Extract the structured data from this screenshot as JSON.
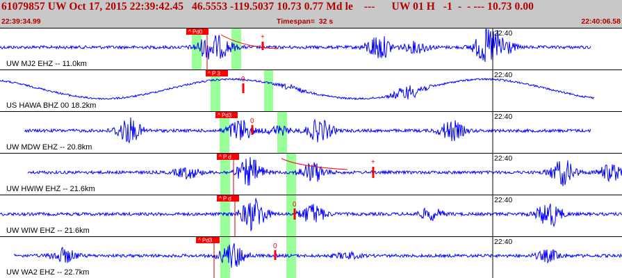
{
  "header": {
    "title": "61079857 UW Oct 17, 2015 22:39:42.45   46.5553 -119.5037 10.73 0.77 Md le    ---      UW 01 H   -1  -  - --- 10.73 0.00",
    "start_time": "22:39:34.99",
    "timespan": "Timespan=  32 s",
    "end_time": "22:40:06.58"
  },
  "channels": [
    {
      "label": "UW MJ2 EHZ -- 11.0km",
      "pick_label": "^ Pd0",
      "marker": "+",
      "minute_label": "22:40",
      "wave": "bursty"
    },
    {
      "label": "US HAWA BHZ 00 18.2km",
      "pick_label": "^ P 3",
      "marker": "0",
      "minute_label": "22:40",
      "wave": "sine"
    },
    {
      "label": "UW MDW EHZ -- 20.8km",
      "pick_label": "^ Pd3",
      "marker": "0",
      "minute_label": "22:40",
      "wave": "bursty"
    },
    {
      "label": "UW HWIW EHZ -- 21.6km",
      "pick_label": "^ P d",
      "marker": "+",
      "minute_label": "22:40",
      "wave": "bursty"
    },
    {
      "label": "UW WIW EHZ -- 21.6km",
      "pick_label": "^ P d",
      "marker": "0",
      "minute_label": "22:40",
      "wave": "bursty"
    },
    {
      "label": "UW WA2 EHZ -- 22.7km",
      "pick_label": "^ Pd3",
      "marker": "0",
      "minute_label": "22:40",
      "wave": "quiet"
    }
  ],
  "colors": {
    "header_bg": "#c8c8c8",
    "header_text": "#b00000",
    "trace": "#0000ff",
    "pick": "#ff0000",
    "window": "#99ff99",
    "divider": "#000000"
  }
}
